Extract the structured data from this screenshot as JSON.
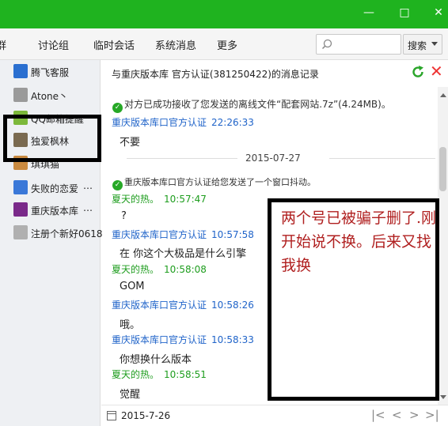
{
  "window": {
    "controls": [
      "—",
      "□",
      "✕"
    ]
  },
  "tabs": [
    {
      "label": "群",
      "name": "tab-group"
    },
    {
      "label": "讨论组",
      "name": "tab-discussion"
    },
    {
      "label": "临时会话",
      "name": "tab-temp-chat"
    },
    {
      "label": "系统消息",
      "name": "tab-system-msg"
    },
    {
      "label": "更多",
      "name": "tab-more"
    }
  ],
  "search": {
    "placeholder": "",
    "button_label": "搜索"
  },
  "sidebar": {
    "contacts": [
      {
        "name": "腾飞客服",
        "avatar_color": "#2a6fd0",
        "icon": "tengfei-logo-icon"
      },
      {
        "name": "Atone丶",
        "avatar_color": "#9a9a9a",
        "icon": "user-photo-icon"
      },
      {
        "name": "QQ邮箱提醒",
        "avatar_color": "#7cb83a",
        "icon": "mail-reminder-icon"
      },
      {
        "name": "独爱枫林",
        "avatar_color": "#7a6a50",
        "icon": "user-photo-icon"
      },
      {
        "name": "琪琪猫",
        "avatar_color": "#c98a40",
        "icon": "user-photo-icon"
      },
      {
        "name": "失败的恋爱",
        "avatar_color": "#3a78d8",
        "icon": "avatar-icon",
        "more": "…"
      },
      {
        "name": "重庆版本库",
        "avatar_color": "#7a2a8a",
        "icon": "avatar-icon",
        "more": "…"
      },
      {
        "name": "注册个新好0618",
        "avatar_color": "#b0b0b0",
        "icon": "user-photo-icon"
      }
    ]
  },
  "chat": {
    "title": "与重庆版本库  官方认证(381250422)的消息记录",
    "file_notice": "对方已成功接收了您发送的离线文件“配套网站.7z”(4.24MB)。",
    "msg1_sender": "重庆版本库口官方认证",
    "msg1_time": "22:26:33",
    "msg1_text": "不要",
    "date_separator": "2015-07-27",
    "shake_notice": "重庆版本库口官方认证给您发送了一个窗口抖动。",
    "msg2_sender": "夏天的热。",
    "msg2_time": "10:57:47",
    "msg2_text": "?",
    "msg3_sender": "重庆版本库口官方认证",
    "msg3_time": "10:57:58",
    "msg3_text": "在 你这个大极品是什么引擎",
    "msg4_sender": "夏天的热。",
    "msg4_time": "10:58:08",
    "msg4_text": "GOM",
    "msg5_sender": "重庆版本库口官方认证",
    "msg5_time": "10:58:26",
    "msg5_text": "哦。",
    "msg6_sender": "重庆版本库口官方认证",
    "msg6_time": "10:58:33",
    "msg6_text": "你想换什么版本",
    "msg7_sender": "夏天的热。",
    "msg7_time": "10:58:51",
    "msg7_text": "觉醒"
  },
  "annotation": {
    "text": "两个号已被骗子删了.刚开始说不换。后来又找我换",
    "color": "#b02020"
  },
  "footer": {
    "date": "2015-7-26",
    "nav": [
      "|<",
      "<",
      ">",
      ">|"
    ]
  },
  "colors": {
    "titlebar": "#1fb31f",
    "sender_blue": "#1f63c9",
    "sender_green": "#1e9d1e"
  }
}
